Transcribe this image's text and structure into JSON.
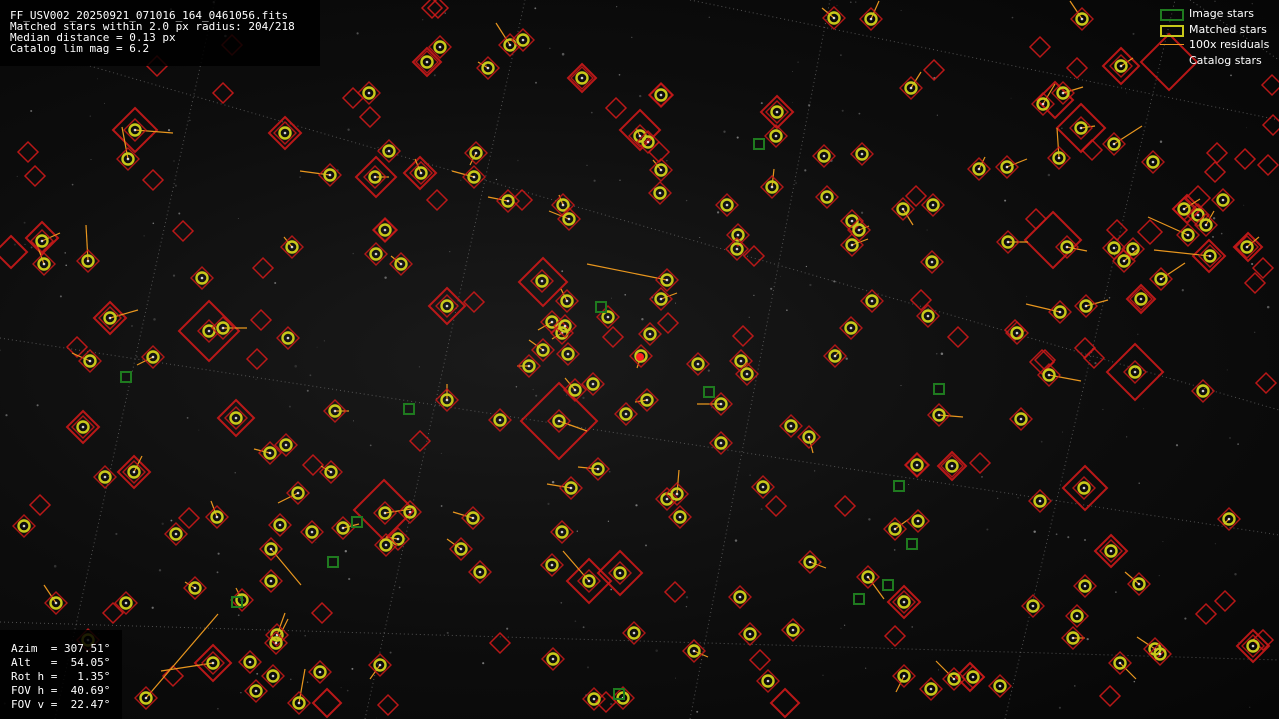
{
  "info": {
    "filename": "FF_USV002_20250921_071016_164_0461056.fits",
    "matched_line": "Matched stars within 2.0 px radius: 204/218",
    "median_line": "Median distance = 0.13 px",
    "catalog_line": "Catalog lim mag = 6.2"
  },
  "pointing": {
    "azim": "Azim  = 307.51°",
    "alt": "Alt   =  54.05°",
    "rot": "Rot h =   1.35°",
    "fov_h": "FOV h =  40.69°",
    "fov_v": "FOV v =  22.47°"
  },
  "legend": {
    "image_stars": "Image stars",
    "matched_stars": "Matched stars",
    "residuals": "100x residuals",
    "catalog_stars": "Catalog stars"
  },
  "colors": {
    "catalog": "#cc1a1a",
    "matched": "#c8c81a",
    "image": "#1f7a1f",
    "residual": "#e8961e",
    "grid": "#8a8a8a",
    "center": "#ff2020"
  }
}
